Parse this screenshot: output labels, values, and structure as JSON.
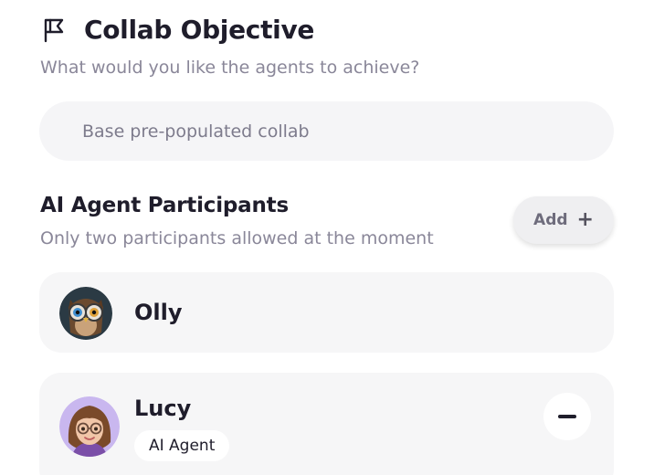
{
  "header": {
    "icon": "flag-icon",
    "title": "Collab Objective",
    "subtitle": "What would you like the agents to achieve?"
  },
  "objective": {
    "placeholder": "Base pre-populated collab",
    "value": ""
  },
  "participants": {
    "title": "AI Agent Participants",
    "subtitle": "Only two participants allowed at the moment",
    "add_label": "Add",
    "add_icon": "plus-icon",
    "items": [
      {
        "name": "Olly",
        "avatar": "owl-avatar"
      },
      {
        "name": "Lucy",
        "avatar": "woman-with-glasses-avatar",
        "badge": "AI Agent",
        "action_icon": "minus-icon"
      }
    ]
  },
  "colors": {
    "text_primary": "#1f1d2b",
    "text_secondary": "#8a8799",
    "surface": "#f5f5f7",
    "button_bg": "#efeff1"
  }
}
